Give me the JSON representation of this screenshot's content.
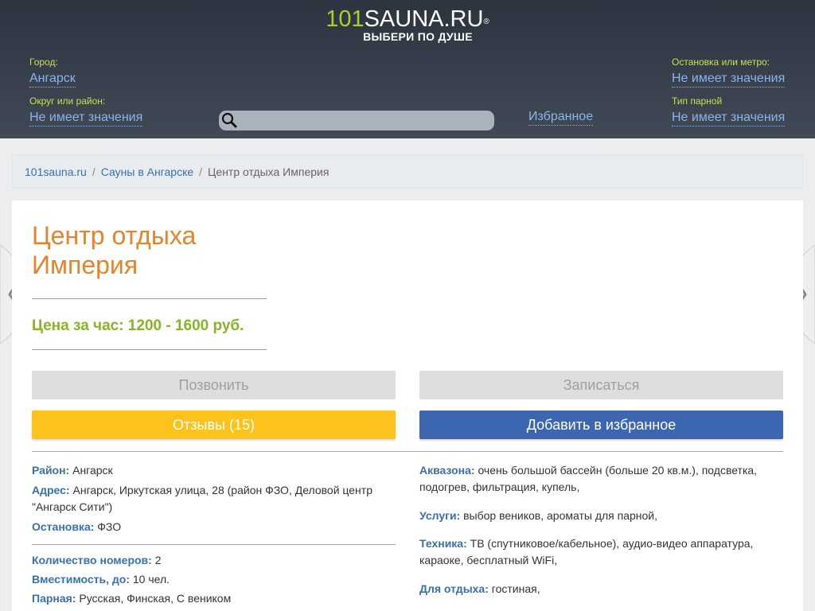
{
  "logo": {
    "num": "101",
    "word": "SAUNA.RU",
    "reg": "®",
    "tagline": "ВЫБЕРИ ПО ДУШЕ"
  },
  "filters": {
    "city_label": "Город:",
    "city_value": "Ангарск",
    "district_label": "Округ или район:",
    "district_value": "Не имеет значения",
    "stop_label": "Остановка или метро:",
    "stop_value": "Не имеет значения",
    "steam_label": "Тип парной",
    "steam_value": "Не имеет значения"
  },
  "search": {
    "placeholder": "",
    "value": ""
  },
  "favorites_link": "Избранное",
  "breadcrumb": {
    "home": "101sauna.ru",
    "section": "Сауны в Ангарске",
    "current": "Центр отдыха Империя",
    "sep": "/"
  },
  "place": {
    "title_line1": "Центр отдыха",
    "title_line2": "Империя",
    "price": "Цена за час: 1200 - 1600 руб."
  },
  "buttons": {
    "call": "Позвонить",
    "book": "Записаться",
    "reviews": "Отзывы (15)",
    "add_fav": "Добавить в избранное"
  },
  "details_left": {
    "district_k": "Район:",
    "district_v": "Ангарск",
    "address_k": "Адрес:",
    "address_v": "Ангарск, Иркутская улица, 28 (район ФЗО, Деловой центр",
    "address_v2": "\"Ангарск Сити\")",
    "stop_k": "Остановка:",
    "stop_v": "ФЗО",
    "rooms_k": "Количество номеров:",
    "rooms_v": "2",
    "capacity_k": "Вместимость, до:",
    "capacity_v": "10 чел.",
    "steam_k": "Парная:",
    "steam_v": "Русская, Финская, С веником"
  },
  "details_right": {
    "aqua_k": "Аквазона:",
    "aqua_v": "очень большой бассейн (больше 20 кв.м.), подсветка,",
    "aqua_v2": "подогрев, фильтрация, купель,",
    "services_k": "Услуги:",
    "services_v": "выбор веников, ароматы для парной,",
    "tech_k": "Техника:",
    "tech_v": "ТВ (спутниковое/кабельное), аудио-видео аппаратура,",
    "tech_v2": "караоке, бесплатный WiFi,",
    "rest_k": "Для отдыха:",
    "rest_v": "гостиная,"
  },
  "colors": {
    "header_dark": "#2c3440",
    "accent_green": "#a7d420",
    "title_orange": "#e8832a",
    "price_green": "#86b623",
    "btn_yellow": "#fbc31b",
    "btn_blue": "#3c67b0",
    "link_blue": "#3a6fb0"
  }
}
